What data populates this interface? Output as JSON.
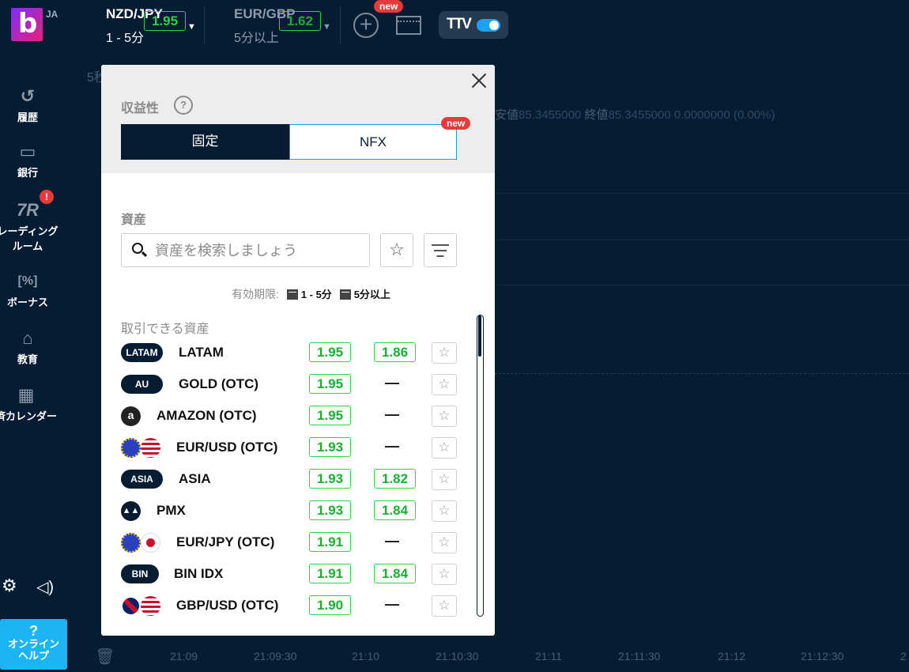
{
  "header": {
    "lang": "JA",
    "logo_letter": "b",
    "active_pair": {
      "name": "NZD/JPY",
      "duration": "1 - 5分",
      "payout": "1.95"
    },
    "inactive_pair": {
      "name": "EUR/GBP",
      "duration": "5分以上",
      "payout": "1.62"
    },
    "new_badge": "new",
    "tv_logo": "T"
  },
  "sidebar": {
    "items": [
      {
        "label": "履歴",
        "icon": "history-icon"
      },
      {
        "label": "銀行",
        "icon": "wallet-icon"
      },
      {
        "label": "レーディング ルーム",
        "icon": "trading-room-icon",
        "badge": "!"
      },
      {
        "label": "ボーナス",
        "icon": "bonus-icon"
      },
      {
        "label": "教育",
        "icon": "education-icon"
      },
      {
        "label": "済カレンダー",
        "icon": "calendar-icon"
      }
    ],
    "help": {
      "q": "?",
      "line1": "オンライン",
      "line2": "ヘルプ"
    }
  },
  "chart": {
    "period_label": "5秒",
    "ohlc": {
      "low_label": "安値",
      "low": "85.3455000",
      "close_label": "終値",
      "close": "85.3455000",
      "change": "0.0000000 (0.00%)"
    },
    "xticks": [
      "21:09",
      "21:09:30",
      "21:10",
      "21:10:30",
      "21:11",
      "21:11:30",
      "21:12",
      "21:12:30",
      "2"
    ]
  },
  "panel": {
    "profit_label": "収益性",
    "qmark": "?",
    "seg_fixed": "固定",
    "seg_nfx": "NFX",
    "new_badge": "new",
    "assets_label": "資産",
    "search_placeholder": "資産を検索しましょう",
    "expiry_label": "有効期限:",
    "expiry_short": "1 - 5分",
    "expiry_long": "5分以上",
    "available_label": "取引できる資産",
    "rows": [
      {
        "tag": "LATAM",
        "name": "LATAM",
        "p1": "1.95",
        "p2": "1.86"
      },
      {
        "tag": "AU",
        "name": "GOLD (OTC)",
        "p1": "1.95",
        "p2": "—"
      },
      {
        "tag": "a",
        "name": "AMAZON (OTC)",
        "p1": "1.95",
        "p2": "—"
      },
      {
        "tag": "EUUS",
        "name": "EUR/USD (OTC)",
        "p1": "1.93",
        "p2": "—"
      },
      {
        "tag": "ASIA",
        "name": "ASIA",
        "p1": "1.93",
        "p2": "1.82"
      },
      {
        "tag": "PMX",
        "name": "PMX",
        "p1": "1.93",
        "p2": "1.84"
      },
      {
        "tag": "EUJP",
        "name": "EUR/JPY (OTC)",
        "p1": "1.91",
        "p2": "—"
      },
      {
        "tag": "BIN",
        "name": "BIN IDX",
        "p1": "1.91",
        "p2": "1.84"
      },
      {
        "tag": "GBUS",
        "name": "GBP/USD (OTC)",
        "p1": "1.90",
        "p2": "—"
      }
    ]
  },
  "colors": {
    "bg": "#061c33",
    "accent": "#1cb4f2",
    "green": "#2ed14a",
    "red": "#e83a3a"
  }
}
